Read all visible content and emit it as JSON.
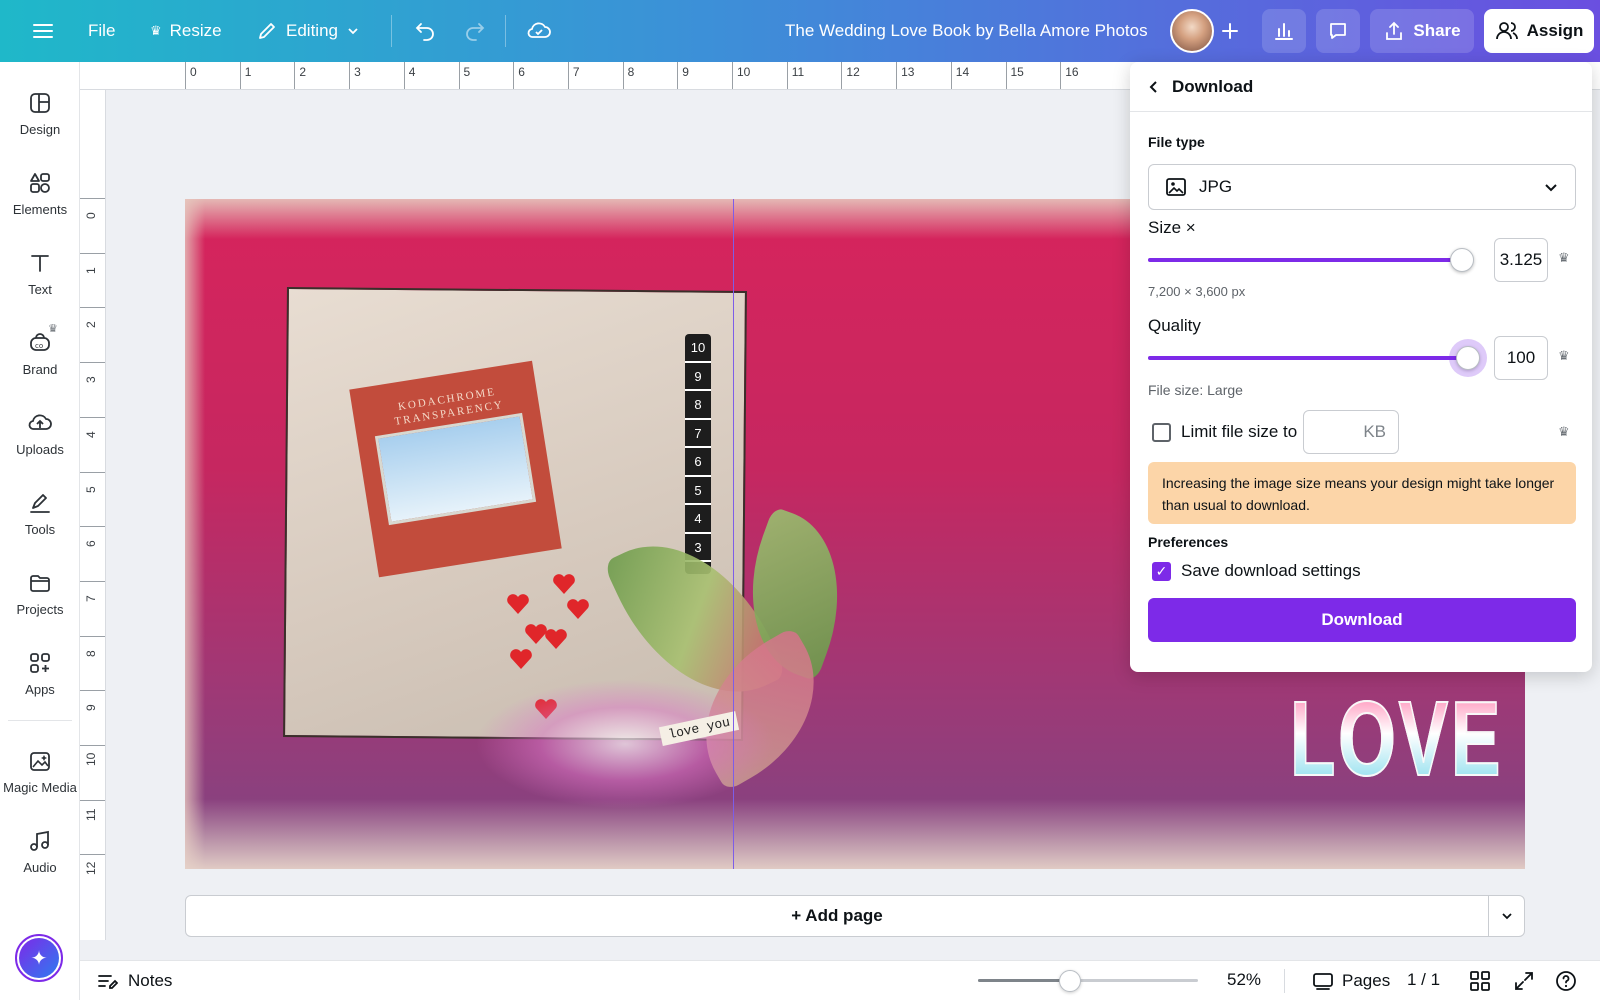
{
  "topbar": {
    "file_label": "File",
    "resize_label": "Resize",
    "editing_label": "Editing",
    "doc_title": "The Wedding Love Book by Bella Amore Photos",
    "share_label": "Share",
    "assign_label": "Assign"
  },
  "sidebar": {
    "items": [
      {
        "label": "Design",
        "icon": "layout-icon"
      },
      {
        "label": "Elements",
        "icon": "shapes-icon"
      },
      {
        "label": "Text",
        "icon": "text-icon"
      },
      {
        "label": "Brand",
        "icon": "brand-icon"
      },
      {
        "label": "Uploads",
        "icon": "cloud-upload-icon"
      },
      {
        "label": "Tools",
        "icon": "pen-icon"
      },
      {
        "label": "Projects",
        "icon": "folder-icon"
      },
      {
        "label": "Apps",
        "icon": "apps-grid-icon"
      },
      {
        "label": "Magic Media",
        "icon": "magic-image-icon"
      },
      {
        "label": "Audio",
        "icon": "music-note-icon"
      }
    ]
  },
  "ruler": {
    "h_labels": [
      "0",
      "1",
      "2",
      "3",
      "4",
      "5",
      "6",
      "7",
      "8",
      "9",
      "10",
      "11",
      "12",
      "13",
      "14",
      "15",
      "16"
    ],
    "v_labels": [
      "0",
      "1",
      "2",
      "3",
      "4",
      "5",
      "6",
      "7",
      "8",
      "9",
      "10",
      "11",
      "12"
    ]
  },
  "canvas": {
    "frame_text": "KODACHROME TRANSPARENCY",
    "love_tag": "love you",
    "strip_numbers": [
      "10",
      "9",
      "8",
      "7",
      "6",
      "5",
      "4",
      "3"
    ],
    "big_word": "LOVE"
  },
  "add_page": {
    "label": "+ Add page"
  },
  "bottombar": {
    "notes_label": "Notes",
    "zoom_percent": 52,
    "zoom_label": "52%",
    "pages_label": "Pages",
    "page_count": "1 / 1"
  },
  "download_panel": {
    "title": "Download",
    "file_type_label": "File type",
    "file_type_value": "JPG",
    "size_label": "Size ×",
    "size_value": "3.125",
    "size_fraction": 0.98,
    "dimensions": "7,200 × 3,600 px",
    "quality_label": "Quality",
    "quality_value": "100",
    "quality_fraction": 1.0,
    "file_size": "File size: Large",
    "limit_label": "Limit file size to",
    "limit_unit": "KB",
    "warning": "Increasing the image size means your design might take longer than usual to download.",
    "preferences_label": "Preferences",
    "save_settings_label": "Save download settings",
    "download_button": "Download"
  },
  "colors": {
    "accent": "#7d2ae8",
    "warning_bg": "#fcd5a8"
  }
}
